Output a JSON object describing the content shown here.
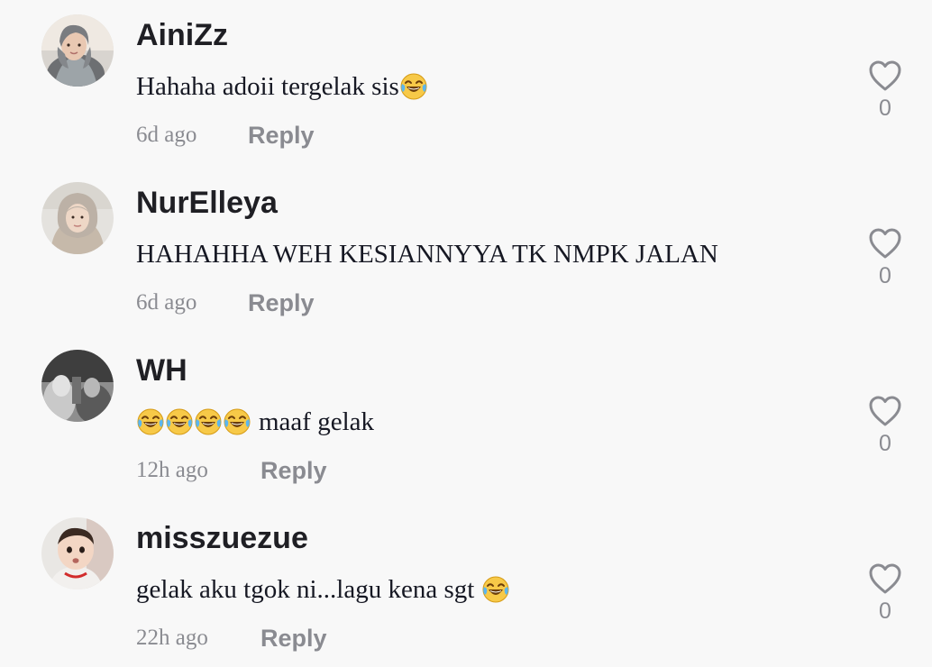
{
  "comments": [
    {
      "username": "AiniZz",
      "text_before": "Hahaha adoii tergelak sis",
      "emoji_count_after": 1,
      "time": "6d ago",
      "reply_label": "Reply",
      "likes": "0",
      "avatar_icon": "avatar-aini"
    },
    {
      "username": "NurElleya",
      "text_before": "HAHAHHA WEH KESIANNYYA TK NMPK JALAN",
      "time": "6d ago",
      "reply_label": "Reply",
      "likes": "0",
      "avatar_icon": "avatar-nurelleya"
    },
    {
      "username": "WH",
      "emoji_count_before": 4,
      "text_after": "maaf gelak",
      "time": "12h ago",
      "reply_label": "Reply",
      "likes": "0",
      "avatar_icon": "avatar-wh"
    },
    {
      "username": "misszuezue",
      "text_before": "gelak aku tgok ni...lagu kena sgt",
      "emoji_count_after": 1,
      "time": "22h ago",
      "reply_label": "Reply",
      "likes": "0",
      "avatar_icon": "avatar-misszuezue"
    }
  ],
  "icons": {
    "like": "heart-outline-icon",
    "emoji": "face-with-tears-of-joy-icon"
  },
  "colors": {
    "background": "#f8f8f8",
    "username": "#1f1f24",
    "text": "#161823",
    "secondary": "#8a8b91"
  }
}
